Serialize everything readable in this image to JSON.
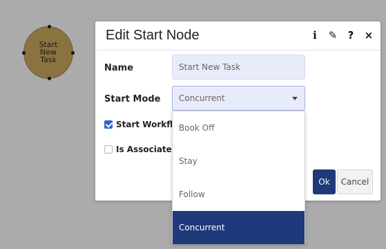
{
  "canvas": {
    "node": {
      "label_lines": [
        "Start",
        "New",
        "Task"
      ],
      "fill_color": "#8a7340"
    }
  },
  "dialog": {
    "title": "Edit Start Node",
    "header_icons": [
      {
        "name": "info-icon",
        "glyph": "i"
      },
      {
        "name": "pencil-icon",
        "glyph": "✎"
      },
      {
        "name": "help-icon",
        "glyph": "?"
      },
      {
        "name": "close-icon",
        "glyph": "×"
      }
    ],
    "fields": {
      "name_label": "Name",
      "name_value": "Start New Task",
      "start_mode_label": "Start Mode",
      "start_mode_value": "Concurrent"
    },
    "checkboxes": [
      {
        "label": "Start Workflow",
        "checked": true
      },
      {
        "label": "Is Associated",
        "checked": false
      }
    ],
    "buttons": {
      "ok": "Ok",
      "cancel": "Cancel"
    },
    "accent_color": "#1e3a7a"
  },
  "dropdown": {
    "options": [
      "Book Off",
      "Stay",
      "Follow",
      "Concurrent"
    ],
    "selected_index": 3
  }
}
